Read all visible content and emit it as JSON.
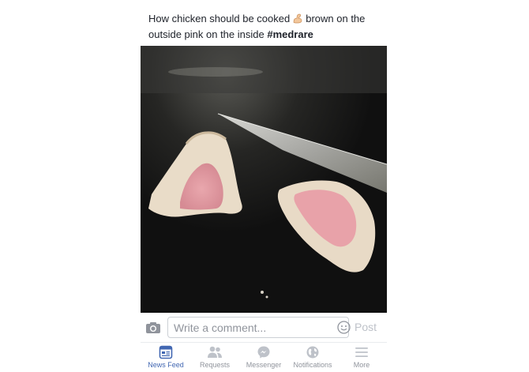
{
  "post": {
    "text_before_emoji": "How chicken should be cooked",
    "text_after_emoji": "brown on the",
    "text_line2": "outside pink on the inside",
    "hashtag": "#medrare",
    "emoji_icon": "flexed-biceps-emoji"
  },
  "comment_bar": {
    "camera_icon": "camera-icon",
    "placeholder": "Write a comment...",
    "emoji_icon": "smiley-icon",
    "post_label": "Post"
  },
  "tabbar": {
    "tabs": [
      {
        "label": "News Feed",
        "icon": "news-feed-icon",
        "active": true
      },
      {
        "label": "Requests",
        "icon": "friend-requests-icon",
        "active": false
      },
      {
        "label": "Messenger",
        "icon": "messenger-icon",
        "active": false
      },
      {
        "label": "Notifications",
        "icon": "globe-icon",
        "active": false
      },
      {
        "label": "More",
        "icon": "menu-icon",
        "active": false
      }
    ],
    "active_color": "#4267b2",
    "inactive_color": "#90949c"
  }
}
